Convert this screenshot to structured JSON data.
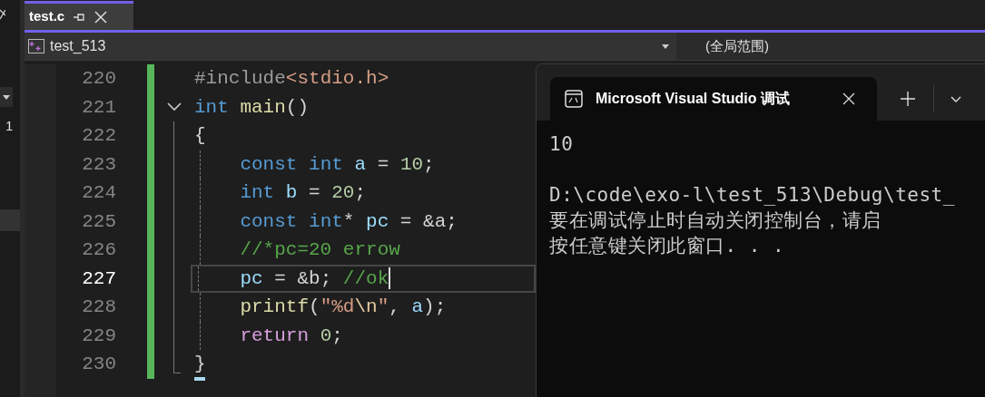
{
  "side_panel": {
    "text": "1"
  },
  "tabs": [
    {
      "label": "test.c",
      "selected": true
    }
  ],
  "nav": {
    "project": "test_513",
    "scope": "(全局范围)"
  },
  "editor": {
    "lines": [
      {
        "number": "220",
        "current": false,
        "fold": false,
        "tokens": [
          {
            "kind": "directive",
            "text": "#include"
          },
          {
            "kind": "string",
            "text": "<stdio.h>"
          }
        ]
      },
      {
        "number": "221",
        "current": false,
        "fold": true,
        "expanded": true,
        "tokens": [
          {
            "kind": "keyword",
            "text": "int"
          },
          {
            "kind": "func",
            "text": " main"
          },
          {
            "kind": "punct",
            "text": "()"
          }
        ]
      },
      {
        "number": "222",
        "current": false,
        "fold": false,
        "tokens": [
          {
            "kind": "punct",
            "text": "{"
          }
        ]
      },
      {
        "number": "223",
        "current": false,
        "fold": false,
        "tokens": [
          {
            "kind": "keyword",
            "text": "    const"
          },
          {
            "kind": "keyword",
            "text": " int"
          },
          {
            "kind": "ident",
            "text": " a"
          },
          {
            "kind": "punct",
            "text": " = "
          },
          {
            "kind": "number",
            "text": "10"
          },
          {
            "kind": "punct",
            "text": ";"
          }
        ]
      },
      {
        "number": "224",
        "current": false,
        "fold": false,
        "tokens": [
          {
            "kind": "keyword",
            "text": "    int"
          },
          {
            "kind": "ident",
            "text": " b"
          },
          {
            "kind": "punct",
            "text": " = "
          },
          {
            "kind": "number",
            "text": "20"
          },
          {
            "kind": "punct",
            "text": ";"
          }
        ]
      },
      {
        "number": "225",
        "current": false,
        "fold": false,
        "tokens": [
          {
            "kind": "keyword",
            "text": "    const"
          },
          {
            "kind": "keyword",
            "text": " int"
          },
          {
            "kind": "punct",
            "text": "*"
          },
          {
            "kind": "ident",
            "text": " pc"
          },
          {
            "kind": "punct",
            "text": " = &a;"
          }
        ]
      },
      {
        "number": "226",
        "current": false,
        "fold": false,
        "tokens": [
          {
            "kind": "comment",
            "text": "    //*pc=20 errow"
          }
        ]
      },
      {
        "number": "227",
        "current": true,
        "fold": false,
        "tokens": [
          {
            "kind": "ident",
            "text": "    pc"
          },
          {
            "kind": "punct",
            "text": " = &b; "
          },
          {
            "kind": "comment",
            "text": "//ok"
          }
        ]
      },
      {
        "number": "228",
        "current": false,
        "fold": false,
        "tokens": [
          {
            "kind": "func",
            "text": "    printf"
          },
          {
            "kind": "punct",
            "text": "("
          },
          {
            "kind": "string",
            "text": "\"%d"
          },
          {
            "kind": "escape",
            "text": "\\n"
          },
          {
            "kind": "string",
            "text": "\""
          },
          {
            "kind": "punct",
            "text": ", "
          },
          {
            "kind": "ident",
            "text": "a"
          },
          {
            "kind": "punct",
            "text": ");"
          }
        ]
      },
      {
        "number": "229",
        "current": false,
        "fold": false,
        "tokens": [
          {
            "kind": "control",
            "text": "    return"
          },
          {
            "kind": "number",
            "text": " 0"
          },
          {
            "kind": "punct",
            "text": ";"
          }
        ]
      },
      {
        "number": "230",
        "current": false,
        "fold": false,
        "tokens": [
          {
            "kind": "punct",
            "text": "}"
          }
        ]
      }
    ]
  },
  "console": {
    "tab_title": "Microsoft Visual Studio 调试",
    "paragraphs": [
      {
        "lines": [
          "10"
        ]
      },
      {
        "lines": [
          "D:\\code\\exo-l\\test_513\\Debug\\test_",
          "要在调试停止时自动关闭控制台，请启",
          "按任意键关闭此窗口. . ."
        ]
      }
    ]
  }
}
